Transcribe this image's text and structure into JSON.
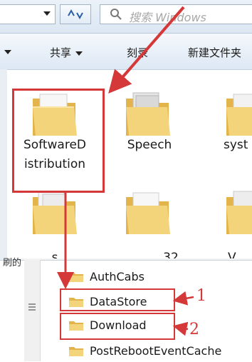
{
  "search": {
    "placeholder": "搜索 Windows"
  },
  "toolbar": {
    "share_label": "共享",
    "burn_label": "刻录",
    "new_folder_label": "新建文件夹"
  },
  "folders": [
    {
      "label_line1": "SoftwareD",
      "label_line2": "istribution"
    },
    {
      "label_line1": "Speech",
      "label_line2": ""
    },
    {
      "label_line1": "syst",
      "label_line2": ""
    },
    {
      "label_line1": "s",
      "label_line2": ""
    },
    {
      "label_line1": "32",
      "label_line2": ""
    },
    {
      "label_line1": "V",
      "label_line2": ""
    }
  ],
  "tree": {
    "left_label": "刷的",
    "items": [
      {
        "label": "AuthCabs"
      },
      {
        "label": "DataStore"
      },
      {
        "label": "Download"
      },
      {
        "label": "PostRebootEventCache"
      }
    ]
  },
  "annotations": {
    "marker_1": "1",
    "marker_2": "2"
  },
  "colors": {
    "annotation_red": "#d43838",
    "folder_yellow": "#f2cd6a"
  }
}
